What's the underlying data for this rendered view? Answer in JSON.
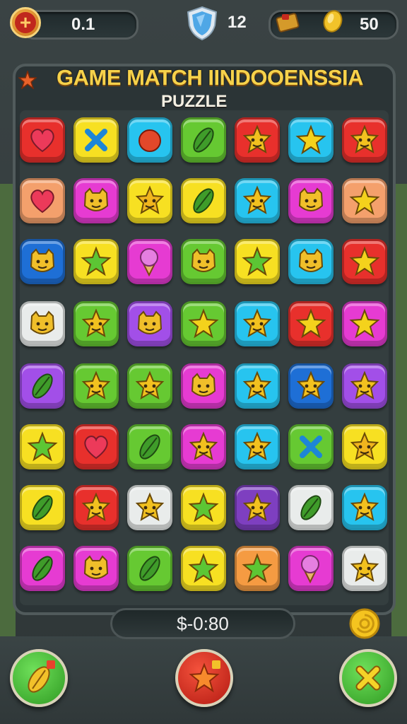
{
  "topbar": {
    "left_value": "0.1",
    "shield_value": "12",
    "coins_value": "50"
  },
  "title": {
    "line1": "GAME MATCH IINDOOENSSIA",
    "line2": "PUZZLE"
  },
  "score_text": "$-0:80",
  "colors": {
    "red": "#e8302c",
    "yellow": "#f7e022",
    "cyan": "#27c4ef",
    "green": "#66c932",
    "orange": "#f4a06c",
    "magenta": "#e63bd2",
    "blue": "#1e6fd6",
    "purple": "#a24fe8",
    "white": "#e9eceb",
    "violet": "#7e3fc0",
    "peach": "#f59b42"
  },
  "board": {
    "rows": [
      [
        {
          "bg": "red",
          "icon": "heart"
        },
        {
          "bg": "yellow",
          "icon": "x"
        },
        {
          "bg": "cyan",
          "icon": "blob"
        },
        {
          "bg": "green",
          "icon": "leaf"
        },
        {
          "bg": "red",
          "icon": "star-face"
        },
        {
          "bg": "cyan",
          "icon": "star"
        },
        {
          "bg": "red",
          "icon": "star-face"
        }
      ],
      [
        {
          "bg": "orange",
          "icon": "heart"
        },
        {
          "bg": "magenta",
          "icon": "cat-face"
        },
        {
          "bg": "yellow",
          "icon": "star-face"
        },
        {
          "bg": "yellow",
          "icon": "leaf"
        },
        {
          "bg": "cyan",
          "icon": "star-face"
        },
        {
          "bg": "magenta",
          "icon": "cat-face"
        },
        {
          "bg": "orange",
          "icon": "star"
        }
      ],
      [
        {
          "bg": "blue",
          "icon": "cat-face"
        },
        {
          "bg": "yellow",
          "icon": "star"
        },
        {
          "bg": "magenta",
          "icon": "icecream"
        },
        {
          "bg": "green",
          "icon": "cat-face"
        },
        {
          "bg": "yellow",
          "icon": "star"
        },
        {
          "bg": "cyan",
          "icon": "cat-face"
        },
        {
          "bg": "red",
          "icon": "star"
        }
      ],
      [
        {
          "bg": "white",
          "icon": "cat-face"
        },
        {
          "bg": "green",
          "icon": "star-face"
        },
        {
          "bg": "purple",
          "icon": "cat-face"
        },
        {
          "bg": "green",
          "icon": "star"
        },
        {
          "bg": "cyan",
          "icon": "star-face"
        },
        {
          "bg": "red",
          "icon": "star"
        },
        {
          "bg": "magenta",
          "icon": "star"
        }
      ],
      [
        {
          "bg": "purple",
          "icon": "leaf"
        },
        {
          "bg": "green",
          "icon": "star-face"
        },
        {
          "bg": "green",
          "icon": "star-face"
        },
        {
          "bg": "magenta",
          "icon": "cat-face"
        },
        {
          "bg": "cyan",
          "icon": "star-face"
        },
        {
          "bg": "blue",
          "icon": "star-face"
        },
        {
          "bg": "purple",
          "icon": "star-face"
        }
      ],
      [
        {
          "bg": "yellow",
          "icon": "star"
        },
        {
          "bg": "red",
          "icon": "heart"
        },
        {
          "bg": "green",
          "icon": "leaf"
        },
        {
          "bg": "magenta",
          "icon": "star-face"
        },
        {
          "bg": "cyan",
          "icon": "star-face"
        },
        {
          "bg": "green",
          "icon": "x"
        },
        {
          "bg": "yellow",
          "icon": "star-face"
        }
      ],
      [
        {
          "bg": "yellow",
          "icon": "leaf"
        },
        {
          "bg": "red",
          "icon": "star-face"
        },
        {
          "bg": "white",
          "icon": "star-face"
        },
        {
          "bg": "yellow",
          "icon": "star"
        },
        {
          "bg": "violet",
          "icon": "star-face"
        },
        {
          "bg": "white",
          "icon": "leaf"
        },
        {
          "bg": "cyan",
          "icon": "star-face"
        }
      ],
      [
        {
          "bg": "magenta",
          "icon": "leaf"
        },
        {
          "bg": "magenta",
          "icon": "cat-face"
        },
        {
          "bg": "green",
          "icon": "leaf"
        },
        {
          "bg": "yellow",
          "icon": "star"
        },
        {
          "bg": "peach",
          "icon": "star"
        },
        {
          "bg": "magenta",
          "icon": "icecream"
        },
        {
          "bg": "white",
          "icon": "star-face"
        }
      ]
    ]
  },
  "icon_colors": {
    "heart": "#ec3a5a",
    "x": "#1d86d6",
    "blob": "#e2482a",
    "leaf": "#3f9c2a",
    "star": "#f4d21c",
    "star-face": "#f2c11f",
    "cat-face": "#f0bf2a",
    "icecream": "#e57fe0"
  },
  "buttons": {
    "left": "leaf-boost-icon",
    "center": "star-boost-icon",
    "right": "cross-boost-icon"
  }
}
